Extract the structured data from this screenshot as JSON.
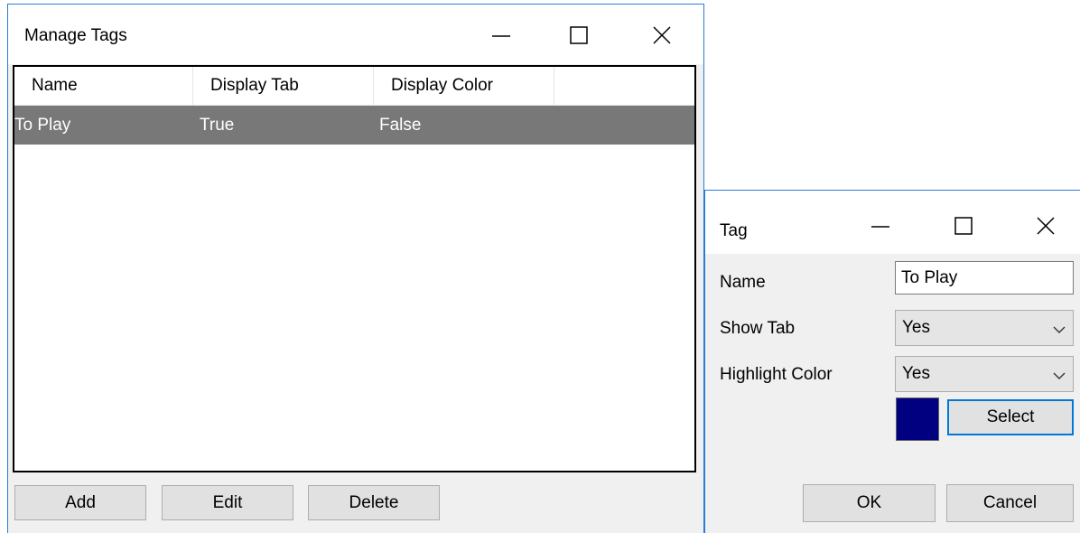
{
  "manage_tags": {
    "title": "Manage Tags",
    "columns": [
      "Name",
      "Display Tab",
      "Display Color"
    ],
    "rows": [
      {
        "name": "To Play",
        "display_tab": "True",
        "display_color": "False"
      }
    ],
    "buttons": {
      "add": "Add",
      "edit": "Edit",
      "delete": "Delete"
    }
  },
  "tag_dialog": {
    "title": "Tag",
    "name_label": "Name",
    "name_value": "To Play",
    "show_tab_label": "Show Tab",
    "show_tab_value": "Yes",
    "highlight_label": "Highlight Color",
    "highlight_value": "Yes",
    "swatch_color": "#000080",
    "select_label": "Select",
    "ok_label": "OK",
    "cancel_label": "Cancel"
  },
  "colors": {
    "window_border": "#2b7bd6",
    "selected_row": "#787878",
    "focus_blue": "#0078d7"
  }
}
